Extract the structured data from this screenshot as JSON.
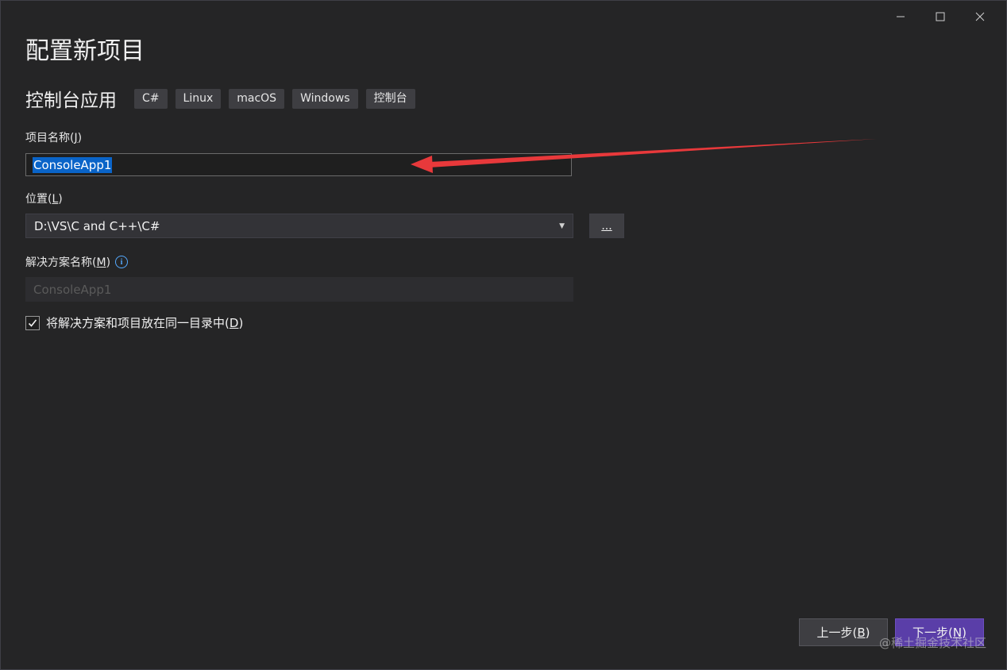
{
  "window": {
    "minimize_glyph": "—",
    "maximize_glyph": "☐",
    "close_glyph": "✕"
  },
  "page_title": "配置新项目",
  "template": {
    "name": "控制台应用",
    "tags": [
      "C#",
      "Linux",
      "macOS",
      "Windows",
      "控制台"
    ]
  },
  "project_name": {
    "label": "项目名称",
    "mnemonic": "J",
    "value": "ConsoleApp1"
  },
  "location": {
    "label": "位置",
    "mnemonic": "L",
    "value": "D:\\VS\\C and C++\\C#",
    "browse_label": "..."
  },
  "solution_name": {
    "label": "解决方案名称",
    "mnemonic": "M",
    "placeholder": "ConsoleApp1"
  },
  "same_directory": {
    "label": "将解决方案和项目放在同一目录中",
    "mnemonic": "D",
    "checked": true
  },
  "footer": {
    "back_label": "上一步",
    "back_mnemonic": "B",
    "next_label": "下一步",
    "next_mnemonic": "N"
  },
  "watermark": "@稀土掘金技术社区",
  "colors": {
    "background": "#252526",
    "accent": "#5a3ea8",
    "selection": "#0a64c8",
    "annotation_arrow": "#e8393b"
  }
}
